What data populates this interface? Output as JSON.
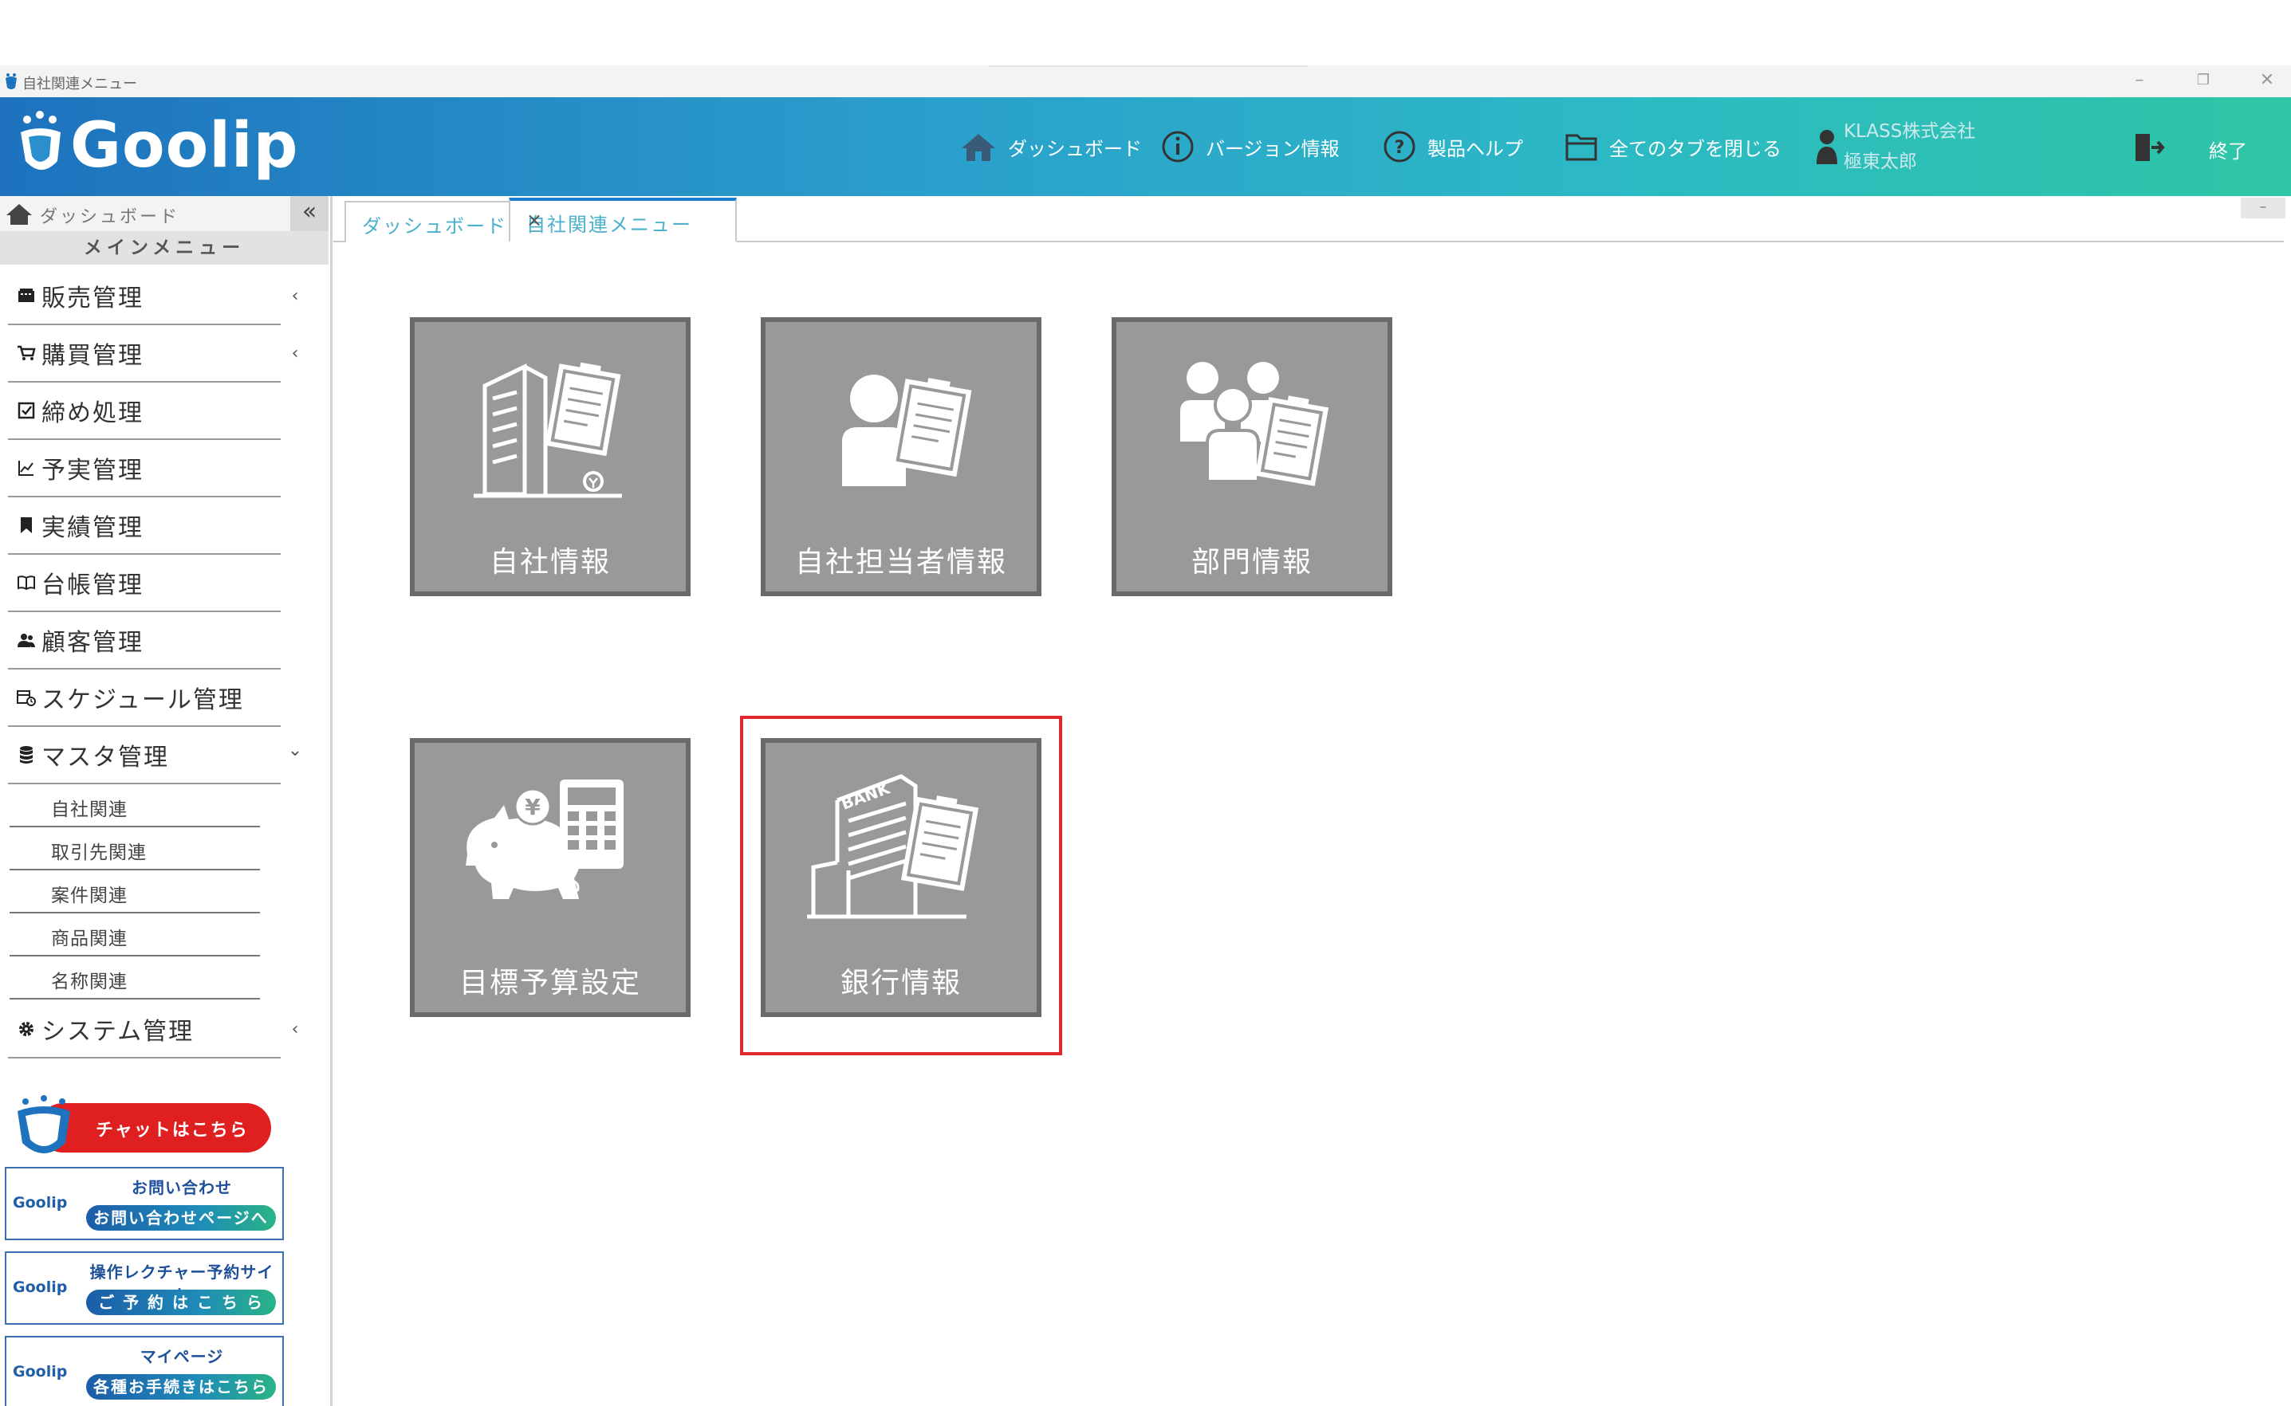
{
  "window": {
    "title": "自社関連メニュー",
    "controls": [
      "minimize-icon",
      "restore-icon",
      "close-icon"
    ]
  },
  "header": {
    "logo_text": "Goolip",
    "nav": [
      {
        "label": "ダッシュボード",
        "icon": "home-icon"
      },
      {
        "label": "バージョン情報",
        "icon": "info-icon"
      },
      {
        "label": "製品ヘルプ",
        "icon": "help-icon"
      },
      {
        "label": "全てのタブを閉じる",
        "icon": "folder-icon"
      }
    ],
    "user": {
      "company": "KLASS株式会社",
      "name": "極東太郎"
    },
    "exit_label": "終了"
  },
  "sidebar": {
    "top_label": "ダッシュボード",
    "collapse_glyph": "«",
    "main_menu_label": "メインメニュー",
    "items": [
      {
        "label": "販売管理",
        "icon": "register-icon",
        "chevron": "‹"
      },
      {
        "label": "購買管理",
        "icon": "cart-icon",
        "chevron": "‹"
      },
      {
        "label": "締め処理",
        "icon": "checkbox-icon"
      },
      {
        "label": "予実管理",
        "icon": "line-chart-icon"
      },
      {
        "label": "実績管理",
        "icon": "bookmark-icon"
      },
      {
        "label": "台帳管理",
        "icon": "book-icon"
      },
      {
        "label": "顧客管理",
        "icon": "users-icon"
      },
      {
        "label": "スケジュール管理",
        "icon": "calendar-clock-icon"
      },
      {
        "label": "マスタ管理",
        "icon": "database-icon",
        "chevron": "⌄"
      },
      {
        "label": "システム管理",
        "icon": "gear-icon",
        "chevron": "‹"
      }
    ],
    "sub_items": [
      "自社関連",
      "取引先関連",
      "案件関連",
      "商品関連",
      "名称関連"
    ],
    "banners": {
      "chat": "チャットはこちら",
      "contact": {
        "logo": "Goolip",
        "title": "お問い合わせ",
        "button": "お問い合わせページへ"
      },
      "lecture": {
        "logo": "Goolip",
        "title": "操作レクチャー予約サイト",
        "button": "ご 予 約 は こ ち ら"
      },
      "mypage": {
        "logo": "Goolip",
        "title": "マイページ",
        "button": "各種お手続きはこちら"
      }
    }
  },
  "tabs": [
    {
      "label": "ダッシュボード",
      "active": false
    },
    {
      "label": "自社関連メニュー",
      "active": true,
      "close": "×"
    }
  ],
  "tab_minimize": "–",
  "tiles": [
    {
      "label": "自社情報",
      "icon": "company-building-icon"
    },
    {
      "label": "自社担当者情報",
      "icon": "staff-document-icon"
    },
    {
      "label": "部門情報",
      "icon": "department-group-icon"
    },
    {
      "label": "目標予算設定",
      "icon": "piggy-bank-calculator-icon"
    },
    {
      "label": "銀行情報",
      "icon": "bank-building-icon",
      "highlighted": true
    }
  ],
  "colors": {
    "header_start": "#1e72be",
    "header_end": "#2fc6a5",
    "tile_bg": "#999999",
    "tile_border": "#6a6a6a",
    "highlight": "#e0282e",
    "tab_text": "#4ab0cc"
  }
}
